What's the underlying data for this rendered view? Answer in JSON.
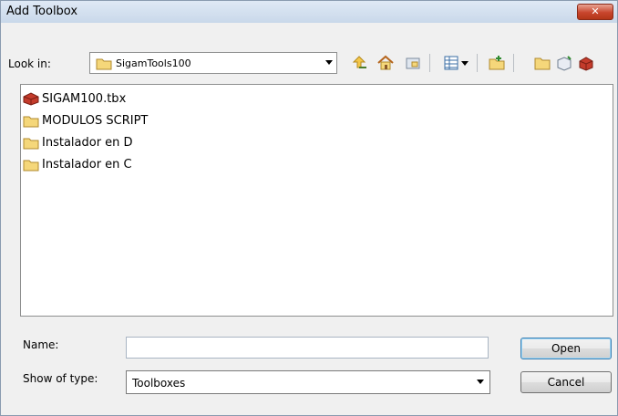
{
  "window": {
    "title": "Add Toolbox",
    "close_glyph": "✕"
  },
  "lookin": {
    "label": "Look in:",
    "value": "SigamTools100"
  },
  "toolbar": {
    "icons": [
      "up-one-level-icon",
      "home-icon",
      "connect-folder-icon",
      "view-details-icon",
      "view-dropdown-icon",
      "new-folder-icon",
      "folder-icon",
      "toolbox-new-icon",
      "toolbox-add-icon"
    ]
  },
  "files": [
    {
      "name": "SIGAM100.tbx",
      "icon": "toolbox-icon"
    },
    {
      "name": "MODULOS SCRIPT",
      "icon": "folder-icon"
    },
    {
      "name": "Instalador en D",
      "icon": "folder-icon"
    },
    {
      "name": "Instalador en C",
      "icon": "folder-icon"
    }
  ],
  "name_field": {
    "label": "Name:",
    "value": ""
  },
  "type_field": {
    "label": "Show of type:",
    "value": "Toolboxes"
  },
  "buttons": {
    "open": "Open",
    "cancel": "Cancel"
  },
  "colors": {
    "title_bar": "#c9d8ea",
    "close": "#c8452d",
    "folder": "#f5d77a",
    "toolbox": "#c43b2b"
  }
}
